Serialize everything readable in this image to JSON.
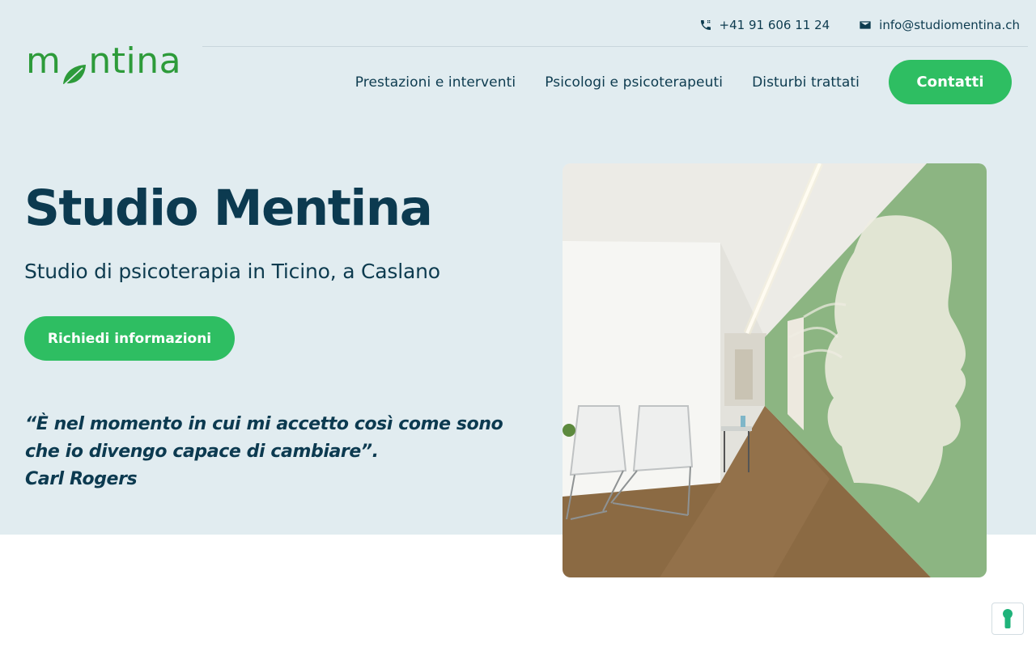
{
  "contact_bar": {
    "phone": "+41 91 606 11 24",
    "email": "info@studiomentina.ch",
    "phone_icon": "phone-icon",
    "email_icon": "mail-icon"
  },
  "logo": {
    "text_before": "m",
    "text_after": "ntina",
    "icon": "leaf-icon"
  },
  "nav": {
    "items": [
      {
        "label": "Prestazioni e interventi"
      },
      {
        "label": "Psicologi e psicoterapeuti"
      },
      {
        "label": "Disturbi trattati"
      }
    ],
    "cta_label": "Contatti"
  },
  "hero": {
    "title": "Studio Mentina",
    "subtitle": "Studio di psicoterapia in Ticino, a Caslano",
    "button_label": "Richiedi informazioni",
    "quote_line1": "“È nel momento in cui mi accetto così come sono",
    "quote_line2": "che io divengo capace di cambiare”.",
    "quote_author": "Carl Rogers"
  },
  "accessibility": {
    "icon": "keyhole-icon"
  },
  "colors": {
    "brand_green": "#2ebe62",
    "logo_green": "#2d9b3a",
    "navy": "#0c3a50",
    "hero_bg": "#e1ecf0"
  }
}
